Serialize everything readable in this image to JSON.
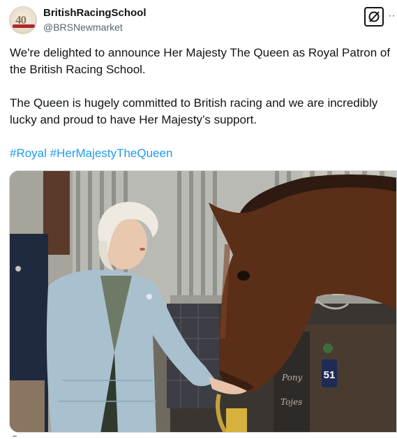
{
  "tweet": {
    "display_name": "BritishRacingSchool",
    "handle": "@BRSNewmarket",
    "avatar_text": "40",
    "paragraph_1": "We're delighted to announce Her Majesty The Queen as Royal Patron of the British Racing School.",
    "paragraph_2": "The Queen is hugely committed to British racing and we are incredibly lucky and proud to have Her Majesty’s support.",
    "hashtags": [
      "#Royal",
      "#HerMajestyTheQueen"
    ],
    "more_icon": "··",
    "grok_icon": "grok-icon",
    "photo": {
      "stall_number": "51",
      "name_plate_line1": "Pony",
      "name_plate_line2": "Tojes"
    }
  },
  "colors": {
    "text": "#0f1419",
    "secondary": "#536471",
    "link": "#1d9bf0",
    "coat": "#a9c0cf",
    "horse": "#5a2e17"
  }
}
